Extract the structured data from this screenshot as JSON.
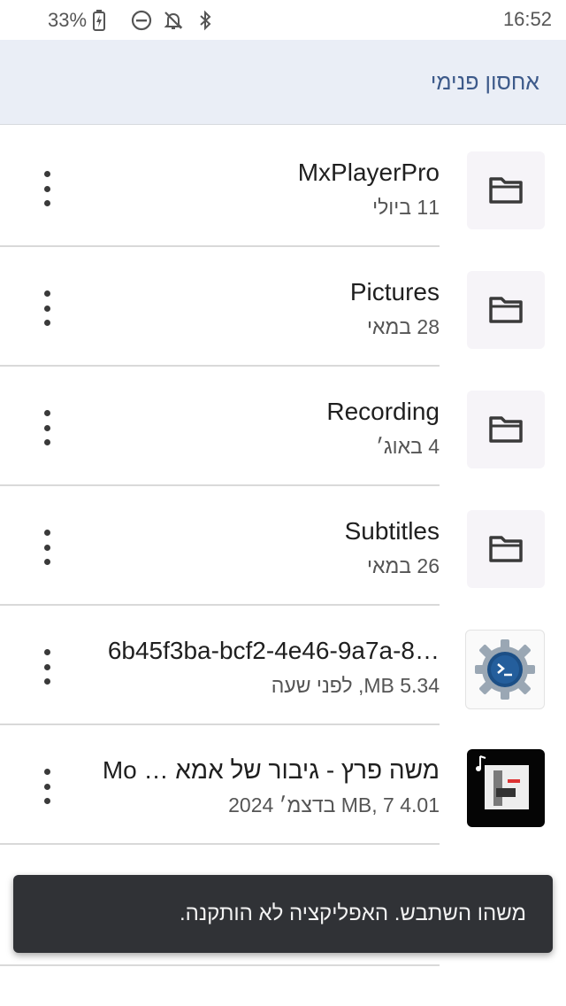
{
  "status_bar": {
    "battery_text": "33%",
    "time": "16:52",
    "icons": [
      "battery-charging-icon",
      "do-not-disturb-icon",
      "notifications-off-icon",
      "bluetooth-icon"
    ]
  },
  "app_bar": {
    "title": "אחסון פנימי"
  },
  "items": [
    {
      "title": "MxPlayerPro",
      "subtitle": "11 ביולי",
      "icon": "folder-icon"
    },
    {
      "title": "Pictures",
      "subtitle": "28 במאי",
      "icon": "folder-icon"
    },
    {
      "title": "Recording",
      "subtitle": "4 באוג׳",
      "icon": "folder-icon"
    },
    {
      "title": "Subtitles",
      "subtitle": "26 במאי",
      "icon": "folder-icon"
    },
    {
      "title": "6b45f3ba-bcf2-4e46-9a7a-8…",
      "subtitle": "5.34 MB, לפני שעה",
      "icon": "settings-app-icon"
    },
    {
      "title": "משה פרץ - גיבור של אמא … Mo",
      "subtitle": "4.01 MB, 7 בדצמ׳ 2024",
      "icon": "audio-file-thumbnail"
    }
  ],
  "snackbar": {
    "message": "משהו השתבש. האפליקציה לא הותקנה."
  },
  "colors": {
    "app_bar_bg": "#eaeef6",
    "title_color": "#3d5a8a",
    "snackbar_bg": "#303236"
  }
}
